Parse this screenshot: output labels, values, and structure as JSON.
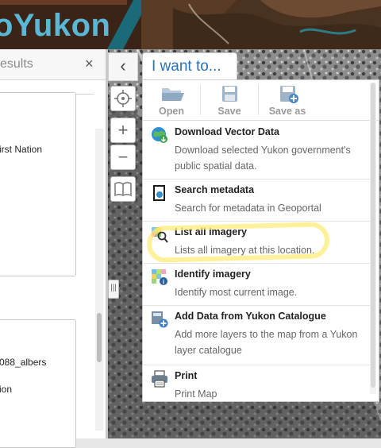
{
  "header": {
    "logo_text": "oYukon"
  },
  "results_panel": {
    "title": "esults",
    "close_label": "×",
    "card1": {
      "text": "irst Nation"
    },
    "card2": {
      "line1": "088_albers",
      "line2": "ion"
    }
  },
  "map_controls": {
    "collapse_label": "‹",
    "locate_icon": "crosshair-icon",
    "zoom_in_label": "+",
    "zoom_out_label": "−",
    "bookmarks_icon": "book-icon",
    "splitter_grip": "|||"
  },
  "iwant": {
    "tab_label": "I want to...",
    "toolbar": [
      {
        "label": "Open",
        "icon": "folder-open-icon"
      },
      {
        "label": "Save",
        "icon": "save-icon"
      },
      {
        "label": "Save as",
        "icon": "save-as-icon"
      }
    ],
    "items": [
      {
        "title": "Download Vector Data",
        "desc": "Download selected Yukon government's public spatial data.",
        "icon": "globe-download-icon"
      },
      {
        "title": "Search metadata",
        "desc": "Search for metadata in Geoportal",
        "icon": "metadata-search-icon"
      },
      {
        "title": "List all imagery",
        "desc": "Lists all imagery at this location.",
        "icon": "imagery-search-icon"
      },
      {
        "title": "Identify imagery",
        "desc": "Identify most current image.",
        "icon": "identify-imagery-icon"
      },
      {
        "title": "Add Data from Yukon Catalogue",
        "desc": "Add more layers to the map from a Yukon layer catalogue",
        "icon": "add-data-icon"
      },
      {
        "title": "Print",
        "desc": "Print Map",
        "icon": "printer-icon"
      }
    ]
  },
  "colors": {
    "accent_blue": "#2a73b8",
    "logo_blue": "#5ab8d6",
    "header_brown": "#3b2417",
    "highlight_yellow": "#ffec78"
  }
}
